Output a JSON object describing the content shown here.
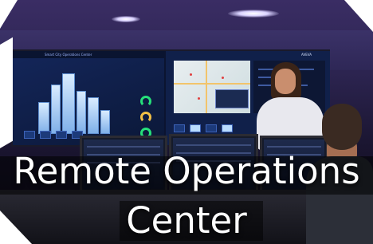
{
  "banner": {
    "title_line1": "Remote Operations",
    "title_line2": "Center"
  },
  "display": {
    "left_header": "Smart City Operations Center",
    "right_brand": "AVEVA"
  },
  "colors": {
    "accent_gauge": "#26e07a",
    "frame": "#ffffff",
    "room": "#2c2450"
  }
}
